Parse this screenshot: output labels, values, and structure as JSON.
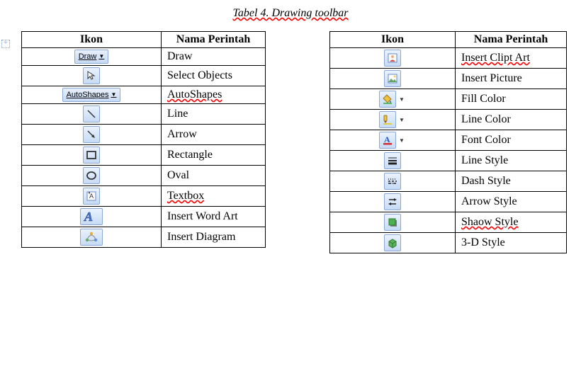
{
  "caption": "Tabel 4. Drawing toolbar",
  "headers": {
    "ikon": "Ikon",
    "nama": "Nama Perintah"
  },
  "buttons": {
    "draw": "Draw",
    "autoshapes": "AutoShapes"
  },
  "left": [
    {
      "icon": "draw-button",
      "name": "Draw"
    },
    {
      "icon": "select-icon",
      "name": "Select Objects"
    },
    {
      "icon": "autoshapes-button",
      "name": "AutoShapes"
    },
    {
      "icon": "line-icon",
      "name": "Line"
    },
    {
      "icon": "arrow-icon",
      "name": "Arrow"
    },
    {
      "icon": "rectangle-icon",
      "name": "Rectangle"
    },
    {
      "icon": "oval-icon",
      "name": "Oval"
    },
    {
      "icon": "textbox-icon",
      "name": "Textbox"
    },
    {
      "icon": "wordart-icon",
      "name": "Insert Word Art"
    },
    {
      "icon": "diagram-icon",
      "name": "Insert Diagram"
    }
  ],
  "right": [
    {
      "icon": "clipart-icon",
      "name": "Insert Clipt Art"
    },
    {
      "icon": "picture-icon",
      "name": "Insert Picture"
    },
    {
      "icon": "fill-color-icon",
      "name": "Fill Color"
    },
    {
      "icon": "line-color-icon",
      "name": "Line Color"
    },
    {
      "icon": "font-color-icon",
      "name": "Font Color"
    },
    {
      "icon": "line-style-icon",
      "name": "Line Style"
    },
    {
      "icon": "dash-style-icon",
      "name": "Dash Style"
    },
    {
      "icon": "arrow-style-icon",
      "name": "Arrow Style"
    },
    {
      "icon": "shadow-style-icon",
      "name": "Shaow Style"
    },
    {
      "icon": "3d-style-icon",
      "name": "3-D Style"
    }
  ]
}
